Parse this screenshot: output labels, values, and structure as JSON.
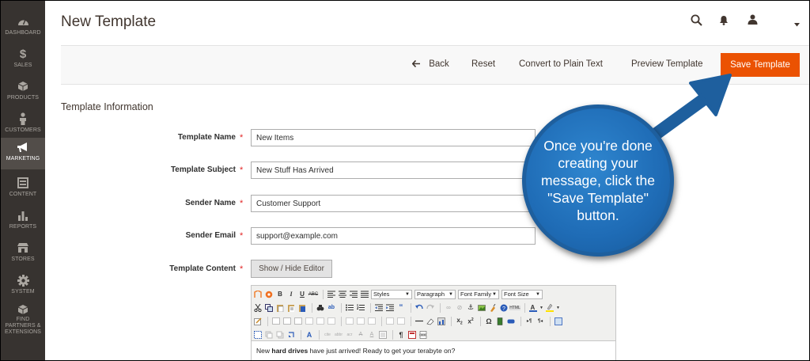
{
  "sidebar": {
    "items": [
      {
        "label": "DASHBOARD",
        "icon": "dashboard-icon"
      },
      {
        "label": "SALES",
        "icon": "dollar-icon"
      },
      {
        "label": "PRODUCTS",
        "icon": "cube-icon"
      },
      {
        "label": "CUSTOMERS",
        "icon": "person-icon"
      },
      {
        "label": "MARKETING",
        "icon": "megaphone-icon"
      },
      {
        "label": "CONTENT",
        "icon": "layout-icon"
      },
      {
        "label": "REPORTS",
        "icon": "bar-chart-icon"
      },
      {
        "label": "STORES",
        "icon": "store-icon"
      },
      {
        "label": "SYSTEM",
        "icon": "gear-icon"
      },
      {
        "label": "FIND PARTNERS & EXTENSIONS",
        "icon": "boxes-icon"
      }
    ]
  },
  "header": {
    "title": "New Template"
  },
  "actions": {
    "back": "Back",
    "reset": "Reset",
    "convert": "Convert to Plain Text",
    "preview": "Preview Template",
    "save": "Save Template"
  },
  "section": {
    "title": "Template Information"
  },
  "form": {
    "template_name": {
      "label": "Template Name",
      "value": "New Items"
    },
    "template_subject": {
      "label": "Template Subject",
      "value": "New Stuff Has Arrived"
    },
    "sender_name": {
      "label": "Sender Name",
      "value": "Customer Support"
    },
    "sender_email": {
      "label": "Sender Email",
      "value": "support@example.com"
    },
    "template_content": {
      "label": "Template Content"
    },
    "required_mark": "*"
  },
  "editor": {
    "toggle_label": "Show / Hide Editor",
    "selects": {
      "styles": "Styles",
      "paragraph": "Paragraph",
      "font_family": "Font Family",
      "font_size": "Font Size"
    },
    "content": {
      "before": "New ",
      "bold": "hard drives",
      "after": " have just arrived! Ready to get your terabyte on?"
    }
  },
  "callout": {
    "text": "Once you're done creating your message, click the \"Save Template\" button."
  },
  "colors": {
    "accent": "#eb5202",
    "sidebar": "#373330",
    "callout": "#1f6cb6"
  }
}
